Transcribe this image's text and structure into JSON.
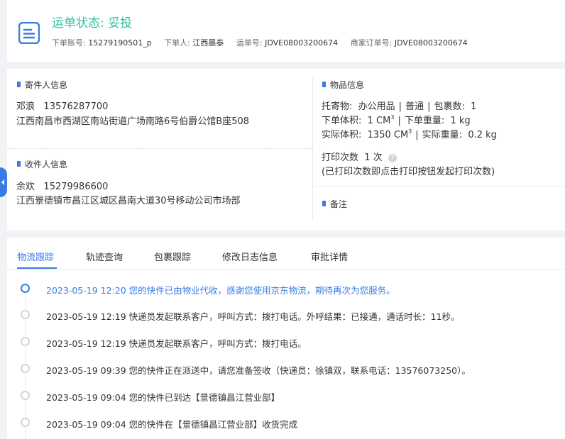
{
  "header": {
    "status": "运单状态: 妥投",
    "order_account_label": "下单账号:",
    "order_account": "15279190501_p",
    "orderer_label": "下单人:",
    "orderer": "江西晨泰",
    "waybill_label": "运单号:",
    "waybill": "JDVE08003200674",
    "merchant_order_label": "商家订单号:",
    "merchant_order": "JDVE08003200674"
  },
  "sender": {
    "title": "寄件人信息",
    "name": "邓浪",
    "phone": "13576287700",
    "address": "江西南昌市西湖区南站街道广场南路6号伯爵公馆B座508"
  },
  "receiver": {
    "title": "收件人信息",
    "name": "余欢",
    "phone": "15279986600",
    "address": "江西景德镇市昌江区城区昌南大道30号移动公司市场部"
  },
  "goods": {
    "title": "物品信息",
    "consign_label": "托寄物:",
    "consign_value": "办公用品",
    "consign_type": "普通",
    "pkg_count_label": "包裹数:",
    "pkg_count": "1",
    "order_volume_label": "下单体积:",
    "order_volume": "1 CM",
    "order_weight_label": "下单重量:",
    "order_weight": "1 kg",
    "actual_volume_label": "实际体积:",
    "actual_volume": "1350 CM",
    "actual_weight_label": "实际重量:",
    "actual_weight": "0.2 kg",
    "volume_exp": "3",
    "print_label": "打印次数",
    "print_count": "1 次",
    "print_hint": "(已打印次数即点击打印按钮发起打印次数)"
  },
  "remark": {
    "title": "备注"
  },
  "tabs": [
    "物流跟踪",
    "轨迹查询",
    "包裹跟踪",
    "修改日志信息",
    "审批详情"
  ],
  "timeline": [
    "2023-05-19 12:20 您的快件已由物业代收，感谢您使用京东物流，期待再次为您服务。",
    "2023-05-19 12:19 快递员发起联系客户，呼叫方式：拨打电话。外呼结果：已接通，通话时长：11秒。",
    "2023-05-19 12:19 快递员发起联系客户，呼叫方式：拨打电话。",
    "2023-05-19 09:39 您的快件正在派送中，请您准备签收（快递员：徐镇双，联系电话：13576073250）。",
    "2023-05-19 09:04 您的快件已到达【景德镇昌江营业部】",
    "2023-05-19 09:04 您的快件在【景德镇昌江营业部】收货完成"
  ],
  "colors": {
    "accent": "#3a7be6",
    "status": "#2ec1a3"
  }
}
